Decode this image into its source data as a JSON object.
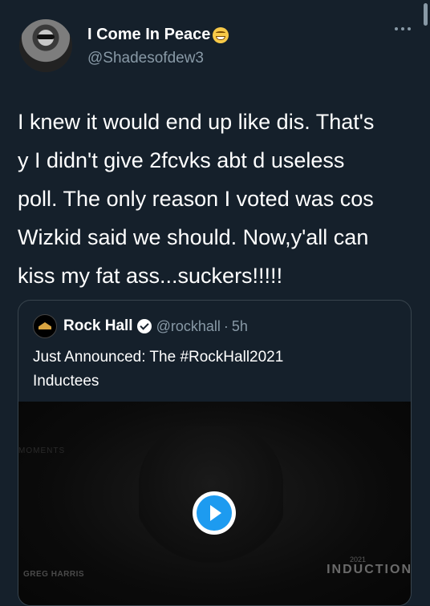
{
  "tweet": {
    "author": {
      "display_name": "I Come In Peace",
      "emoji": "grinning-face-emoji",
      "handle": "@Shadesofdew3"
    },
    "text": "I knew it would end up like dis. That's\ny I didn't give 2fcvks abt d useless\npoll. The only reason I voted was cos\nWizkid said we should. Now,y'all can\nkiss my fat ass...suckers!!!!!"
  },
  "quoted_tweet": {
    "author": {
      "display_name": "Rock Hall",
      "verified": true,
      "handle": "@rockhall",
      "separator": "·",
      "time": "5h"
    },
    "text": "Just Announced: The #RockHall2021\nInductees",
    "media": {
      "type": "video",
      "caption_left": "GREG HARRIS",
      "caption_year": "2021",
      "caption_right": "INDUCTION",
      "ghost_text": "MOMENTS"
    }
  },
  "colors": {
    "background": "#15202b",
    "border": "#38444d",
    "secondary_text": "#8899a6",
    "accent": "#1d9bf0"
  }
}
